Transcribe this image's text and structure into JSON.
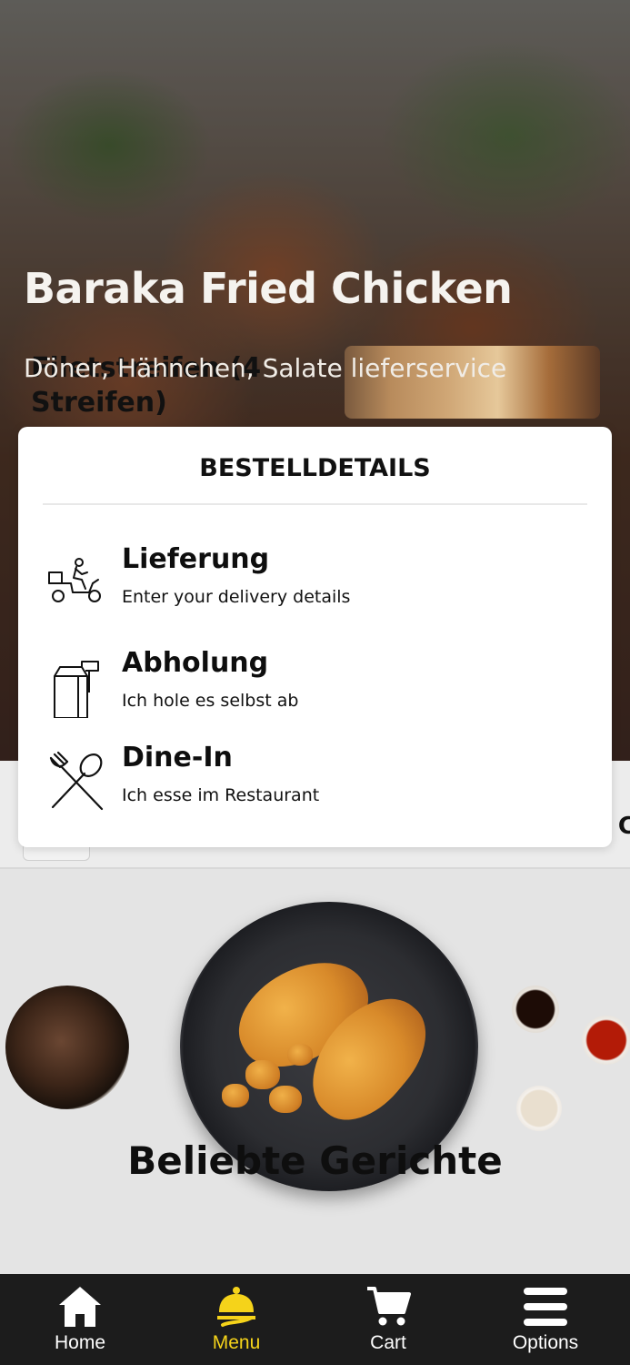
{
  "restaurant": {
    "name": "Baraka Fried Chicken",
    "tagline": "Döner, Hähnchen, Salate lieferservice"
  },
  "order_details": {
    "title": "BESTELLDETAILS",
    "options": [
      {
        "icon": "delivery-scooter-icon",
        "title": "Lieferung",
        "description": "Enter your delivery details"
      },
      {
        "icon": "takeaway-bag-icon",
        "title": "Abholung",
        "description": "Ich hole es selbst ab"
      },
      {
        "icon": "fork-spoon-icon",
        "title": "Dine-In",
        "description": "Ich esse im Restaurant"
      }
    ]
  },
  "partial_text": "l C",
  "banner": {
    "title": "Beliebte Gerichte"
  },
  "dish": {
    "name": "Filetstreifen (4 Streifen)"
  },
  "bottom_nav": {
    "items": [
      {
        "label": "Home",
        "icon": "home-icon",
        "active": false
      },
      {
        "label": "Menu",
        "icon": "cloche-icon",
        "active": true
      },
      {
        "label": "Cart",
        "icon": "cart-icon",
        "active": false
      },
      {
        "label": "Options",
        "icon": "hamburger-menu-icon",
        "active": false
      }
    ]
  },
  "colors": {
    "nav_background": "#1c1c1c",
    "active_accent": "#f5d31a",
    "card_background": "#ffffff"
  }
}
